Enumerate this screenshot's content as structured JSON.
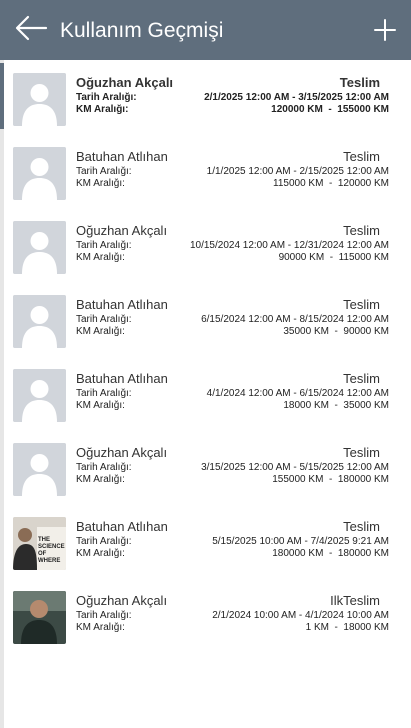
{
  "header": {
    "title": "Kullanım Geçmişi"
  },
  "labels": {
    "date_range": "Tarih Aralığı:",
    "km_range": "KM Aralığı:"
  },
  "items": [
    {
      "name": "Oğuzhan Akçalı",
      "status": "Teslim",
      "date_range": "2/1/2025 12:00 AM - 3/15/2025 12:00 AM",
      "km_range": "120000 KM  -  155000 KM",
      "avatar": "placeholder",
      "selected": true
    },
    {
      "name": "Batuhan Atlıhan",
      "status": "Teslim",
      "date_range": "1/1/2025 12:00 AM - 2/15/2025 12:00 AM",
      "km_range": "115000 KM  -  120000 KM",
      "avatar": "placeholder",
      "selected": false
    },
    {
      "name": "Oğuzhan Akçalı",
      "status": "Teslim",
      "date_range": "10/15/2024 12:00 AM - 12/31/2024 12:00 AM",
      "km_range": "90000 KM  -  115000 KM",
      "avatar": "placeholder",
      "selected": false
    },
    {
      "name": "Batuhan Atlıhan",
      "status": "Teslim",
      "date_range": "6/15/2024 12:00 AM - 8/15/2024 12:00 AM",
      "km_range": "35000 KM  -  90000 KM",
      "avatar": "placeholder",
      "selected": false
    },
    {
      "name": "Batuhan Atlıhan",
      "status": "Teslim",
      "date_range": "4/1/2024 12:00 AM - 6/15/2024 12:00 AM",
      "km_range": "18000 KM  -  35000 KM",
      "avatar": "placeholder",
      "selected": false
    },
    {
      "name": "Oğuzhan Akçalı",
      "status": "Teslim",
      "date_range": "3/15/2025 12:00 AM - 5/15/2025 12:00 AM",
      "km_range": "155000 KM  -  180000 KM",
      "avatar": "placeholder",
      "selected": false
    },
    {
      "name": "Batuhan Atlıhan",
      "status": "Teslim",
      "date_range": "5/15/2025 10:00 AM - 7/4/2025 9:21 AM",
      "km_range": "180000 KM  -  180000 KM",
      "avatar": "photo",
      "avatar_text": "THE SCIENCE OF WHERE",
      "selected": false
    },
    {
      "name": "Oğuzhan Akçalı",
      "status": "IlkTeslim",
      "date_range": "2/1/2024 10:00 AM - 4/1/2024 10:00 AM",
      "km_range": "1 KM  -  18000 KM",
      "avatar": "photo",
      "selected": false
    }
  ],
  "colors": {
    "header": "#5f6e7d",
    "avatar_bg": "#d1d5db",
    "avatar_fg": "#ffffff"
  }
}
